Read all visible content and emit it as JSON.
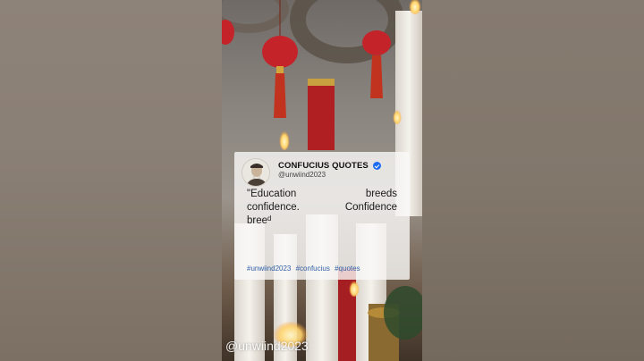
{
  "card": {
    "account_name": "CONFUCIUS QUOTES",
    "handle": "@unwiind2023",
    "quote_lines": [
      [
        "\"Education",
        "breeds"
      ],
      [
        "confidence.",
        "Confidence"
      ]
    ],
    "quote_last_main": "bree",
    "quote_last_tail": "d",
    "hashtags": [
      "#unwiind2023",
      "#confucius",
      "#quotes"
    ]
  },
  "watermark": "@unwiind2023",
  "icons": {
    "verified": "verified-badge-icon",
    "avatar": "confucius-avatar"
  },
  "colors": {
    "verified": "#1d6cf0",
    "hashtag": "#2f5fa8"
  }
}
